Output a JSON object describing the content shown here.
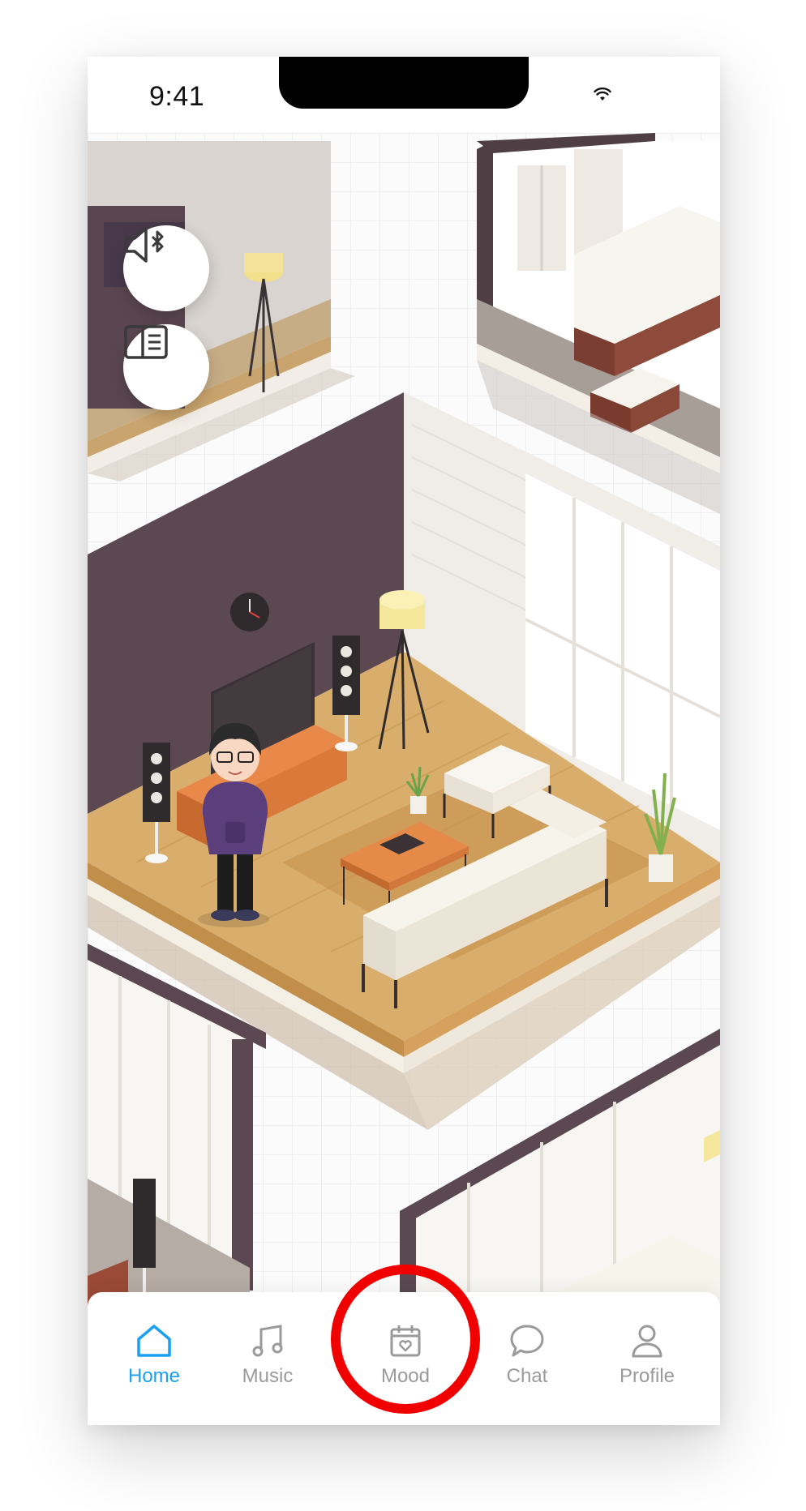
{
  "status_bar": {
    "time": "9:41",
    "wifi_icon": "wifi-icon"
  },
  "floating_controls": [
    {
      "icon": "speaker-bluetooth-icon"
    },
    {
      "icon": "reader-layout-icon"
    }
  ],
  "tab_bar": {
    "active": "Home",
    "accent_color": "#1a9ff2",
    "inactive_color": "#9a9a9a",
    "tabs": [
      {
        "label": "Home",
        "icon": "home-icon"
      },
      {
        "label": "Music",
        "icon": "music-note-icon"
      },
      {
        "label": "Mood",
        "icon": "calendar-heart-icon"
      },
      {
        "label": "Chat",
        "icon": "chat-bubble-icon"
      },
      {
        "label": "Profile",
        "icon": "person-icon"
      }
    ]
  },
  "annotation": {
    "highlight_color": "#f10000",
    "highlighted_tab": "Mood"
  }
}
